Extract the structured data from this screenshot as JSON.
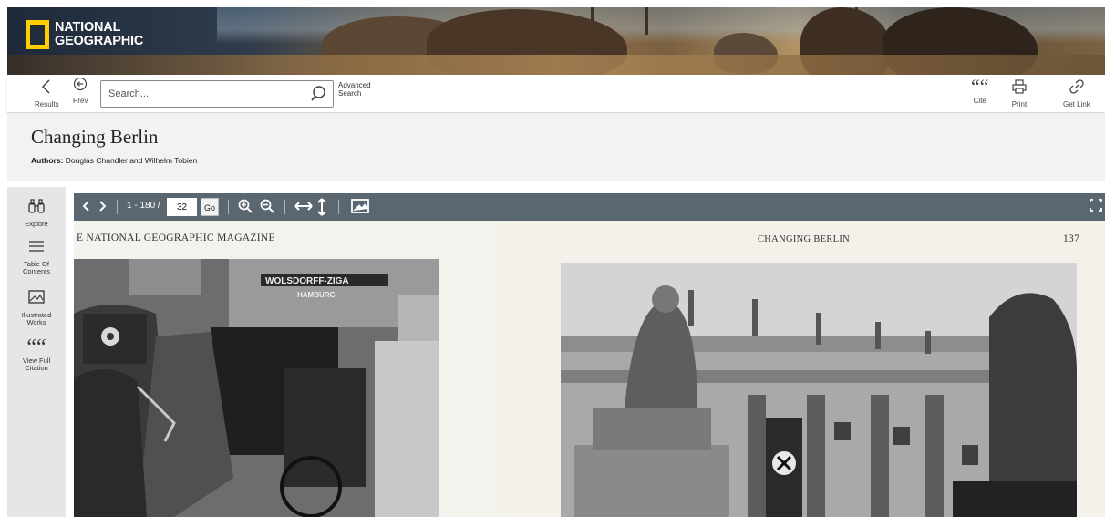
{
  "brand": {
    "logo_line1": "NATIONAL",
    "logo_line2": "GEOGRAPHIC",
    "accent": "#ffce00"
  },
  "toolbar": {
    "results_label": "Results",
    "prev_label": "Prev",
    "search_placeholder": "Search...",
    "advanced_line1": "Advanced",
    "advanced_line2": "Search",
    "cite_label": "Cite",
    "print_label": "Print",
    "get_link_label": "Get Link",
    "icons": [
      "chevron-left-icon",
      "circle-arrow-left-icon",
      "search-icon",
      "quote-icon",
      "printer-icon",
      "link-icon"
    ]
  },
  "document": {
    "title": "Changing Berlin",
    "authors_label": "Authors:",
    "authors": "Douglas Chandler and Wilhelm Tobien"
  },
  "sidebar": {
    "items": [
      {
        "label1": "Explore",
        "label2": "",
        "label3": "",
        "icon": "binoculars-icon"
      },
      {
        "label1": "Table Of",
        "label2": "Contents",
        "label3": "",
        "icon": "list-icon"
      },
      {
        "label1": "Illustrated",
        "label2": "Works",
        "label3": "",
        "icon": "image-icon"
      },
      {
        "label1": "View Full",
        "label2": "Citation",
        "label3": "",
        "icon": "quote-icon"
      }
    ]
  },
  "viewer": {
    "page_range": "1 - 180 /",
    "current_page": "32",
    "go_label": "Go",
    "bar_color": "#5a6670",
    "left_running_head": "E NATIONAL GEOGRAPHIC MAGAZINE",
    "right_running_head": "CHANGING BERLIN",
    "right_page_number": "137",
    "photo_sign_1": "WOLSDORFF-ZIGA",
    "photo_sign_2": "HAMBURG"
  }
}
